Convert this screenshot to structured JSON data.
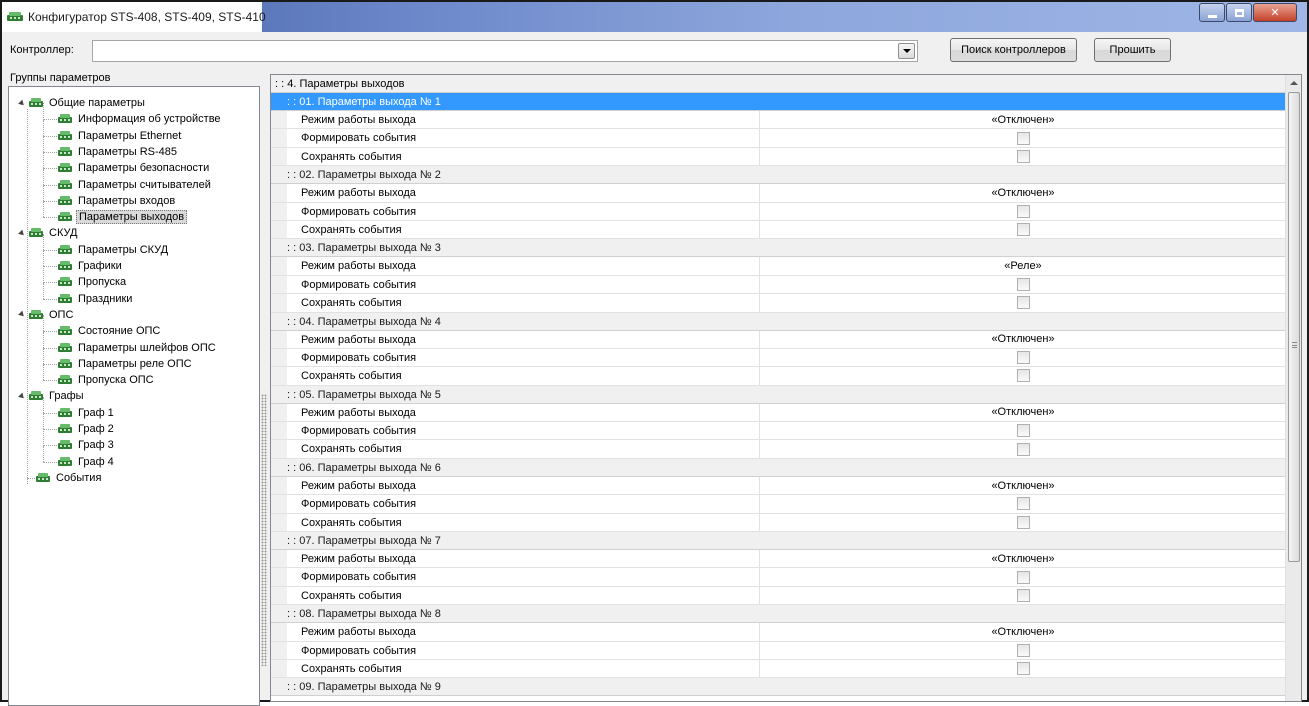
{
  "window": {
    "title": "Конфигуратор STS-408, STS-409, STS-410",
    "colors": {
      "selection": "#3399ff",
      "titlebar": "#6a86c8"
    }
  },
  "toolbar": {
    "controller_label": "Контроллер:",
    "controller_value": "",
    "search_button": "Поиск контроллеров",
    "flash_button": "Прошить"
  },
  "tree": {
    "header": "Группы параметров",
    "items": [
      {
        "label": "Общие параметры",
        "level": 0,
        "expanded": true
      },
      {
        "label": "Информация об устройстве",
        "level": 1
      },
      {
        "label": "Параметры Ethernet",
        "level": 1
      },
      {
        "label": "Параметры RS-485",
        "level": 1
      },
      {
        "label": "Параметры безопасности",
        "level": 1
      },
      {
        "label": "Параметры считывателей",
        "level": 1
      },
      {
        "label": "Параметры входов",
        "level": 1
      },
      {
        "label": "Параметры выходов",
        "level": 1,
        "selected": true
      },
      {
        "label": "СКУД",
        "level": 0,
        "expanded": true
      },
      {
        "label": "Параметры СКУД",
        "level": 1
      },
      {
        "label": "Графики",
        "level": 1
      },
      {
        "label": "Пропуска",
        "level": 1
      },
      {
        "label": "Праздники",
        "level": 1
      },
      {
        "label": "ОПС",
        "level": 0,
        "expanded": true
      },
      {
        "label": "Состояние ОПС",
        "level": 1
      },
      {
        "label": "Параметры шлейфов ОПС",
        "level": 1
      },
      {
        "label": "Параметры реле ОПС",
        "level": 1
      },
      {
        "label": "Пропуска ОПС",
        "level": 1
      },
      {
        "label": "Графы",
        "level": 0,
        "expanded": true
      },
      {
        "label": "Граф 1",
        "level": 1
      },
      {
        "label": "Граф 2",
        "level": 1
      },
      {
        "label": "Граф 3",
        "level": 1
      },
      {
        "label": "Граф 4",
        "level": 1
      },
      {
        "label": "События",
        "level": 0,
        "leaf": true
      }
    ]
  },
  "grid": {
    "title": ": : 4. Параметры выходов",
    "param_labels": {
      "mode": "Режим работы выхода",
      "form_events": "Формировать события",
      "save_events": "Сохранять события"
    },
    "groups": [
      {
        "title": ": : 01. Параметры выхода № 1",
        "mode": "«Отключен»",
        "form_events": false,
        "save_events": false,
        "selected": true
      },
      {
        "title": ": : 02. Параметры выхода № 2",
        "mode": "«Отключен»",
        "form_events": false,
        "save_events": false
      },
      {
        "title": ": : 03. Параметры выхода № 3",
        "mode": "«Реле»",
        "form_events": false,
        "save_events": false
      },
      {
        "title": ": : 04. Параметры выхода № 4",
        "mode": "«Отключен»",
        "form_events": false,
        "save_events": false
      },
      {
        "title": ": : 05. Параметры выхода № 5",
        "mode": "«Отключен»",
        "form_events": false,
        "save_events": false
      },
      {
        "title": ": : 06. Параметры выхода № 6",
        "mode": "«Отключен»",
        "form_events": false,
        "save_events": false
      },
      {
        "title": ": : 07. Параметры выхода № 7",
        "mode": "«Отключен»",
        "form_events": false,
        "save_events": false
      },
      {
        "title": ": : 08. Параметры выхода № 8",
        "mode": "«Отключен»",
        "form_events": false,
        "save_events": false
      },
      {
        "title": ": : 09. Параметры выхода № 9"
      }
    ]
  }
}
